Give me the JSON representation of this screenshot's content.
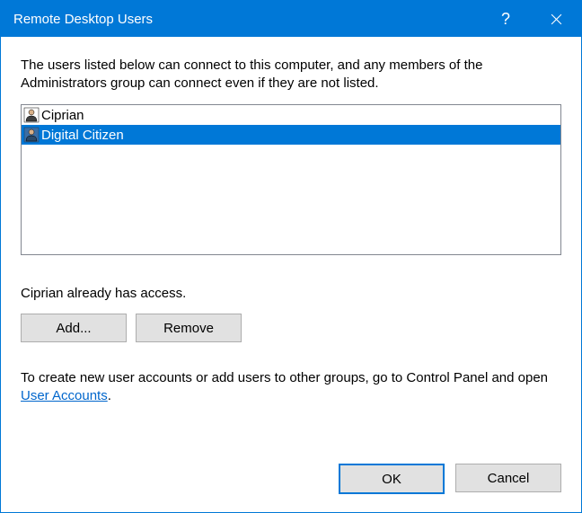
{
  "window": {
    "title": "Remote Desktop Users"
  },
  "description": "The users listed below can connect to this computer, and any members of the Administrators group can connect even if they are not listed.",
  "users": {
    "items": [
      {
        "name": "Ciprian",
        "selected": false
      },
      {
        "name": "Digital Citizen",
        "selected": true
      }
    ]
  },
  "access_text": "Ciprian already has access.",
  "buttons": {
    "add": "Add...",
    "remove": "Remove",
    "ok": "OK",
    "cancel": "Cancel"
  },
  "hint": {
    "prefix": "To create new user accounts or add users to other groups, go to Control Panel and open ",
    "link": "User Accounts",
    "suffix": "."
  }
}
